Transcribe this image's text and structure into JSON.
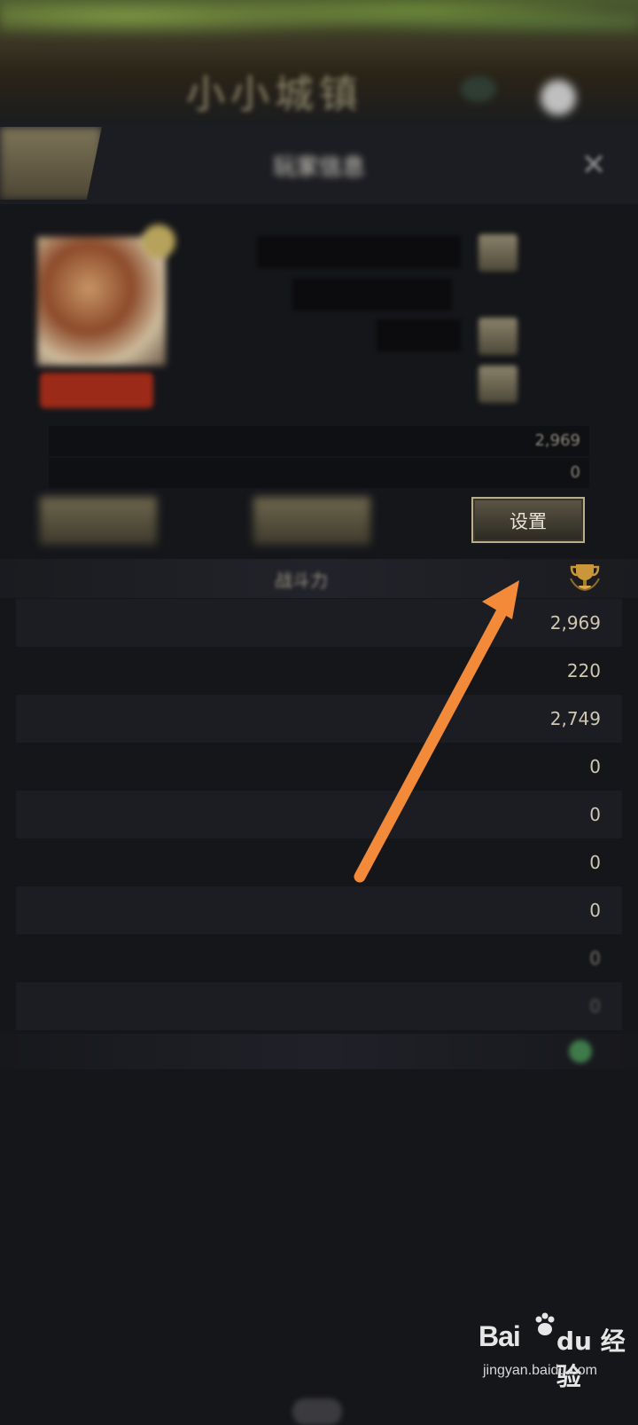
{
  "banner": {
    "title": "小小城镇"
  },
  "header": {
    "title": "玩家信息",
    "close_glyph": "✕"
  },
  "profile": {
    "avatar_tag": "",
    "info_rows": [
      "",
      "",
      "",
      ""
    ],
    "stat_a": {
      "label": "",
      "value": "2,969"
    },
    "stat_b": {
      "label": "",
      "value": "0"
    }
  },
  "buttons": {
    "settings_label": "设置"
  },
  "power": {
    "title": "战斗力",
    "rows": [
      {
        "label": "",
        "value": "2,969"
      },
      {
        "label": "",
        "value": "220"
      },
      {
        "label": "",
        "value": "2,749"
      },
      {
        "label": "",
        "value": "0"
      },
      {
        "label": "",
        "value": "0"
      },
      {
        "label": "",
        "value": "0"
      },
      {
        "label": "",
        "value": "0"
      },
      {
        "label": "",
        "value": "0"
      },
      {
        "label": "",
        "value": "0"
      }
    ]
  },
  "lower": {
    "title": "",
    "rows": [
      {
        "label": "",
        "value": ""
      },
      {
        "label": "",
        "value": ""
      },
      {
        "label": "",
        "value": ""
      },
      {
        "label": "",
        "value": ""
      },
      {
        "label": "",
        "value": ""
      },
      {
        "label": "",
        "value": ""
      }
    ]
  },
  "annotation": {
    "arrow_color": "#f28a3a"
  },
  "watermark": {
    "logo_a": "Bai",
    "logo_b": "du 经验",
    "url": "jingyan.baidu.com"
  },
  "colors": {
    "accent_gold": "#b9ae8a",
    "background": "#15161a"
  }
}
